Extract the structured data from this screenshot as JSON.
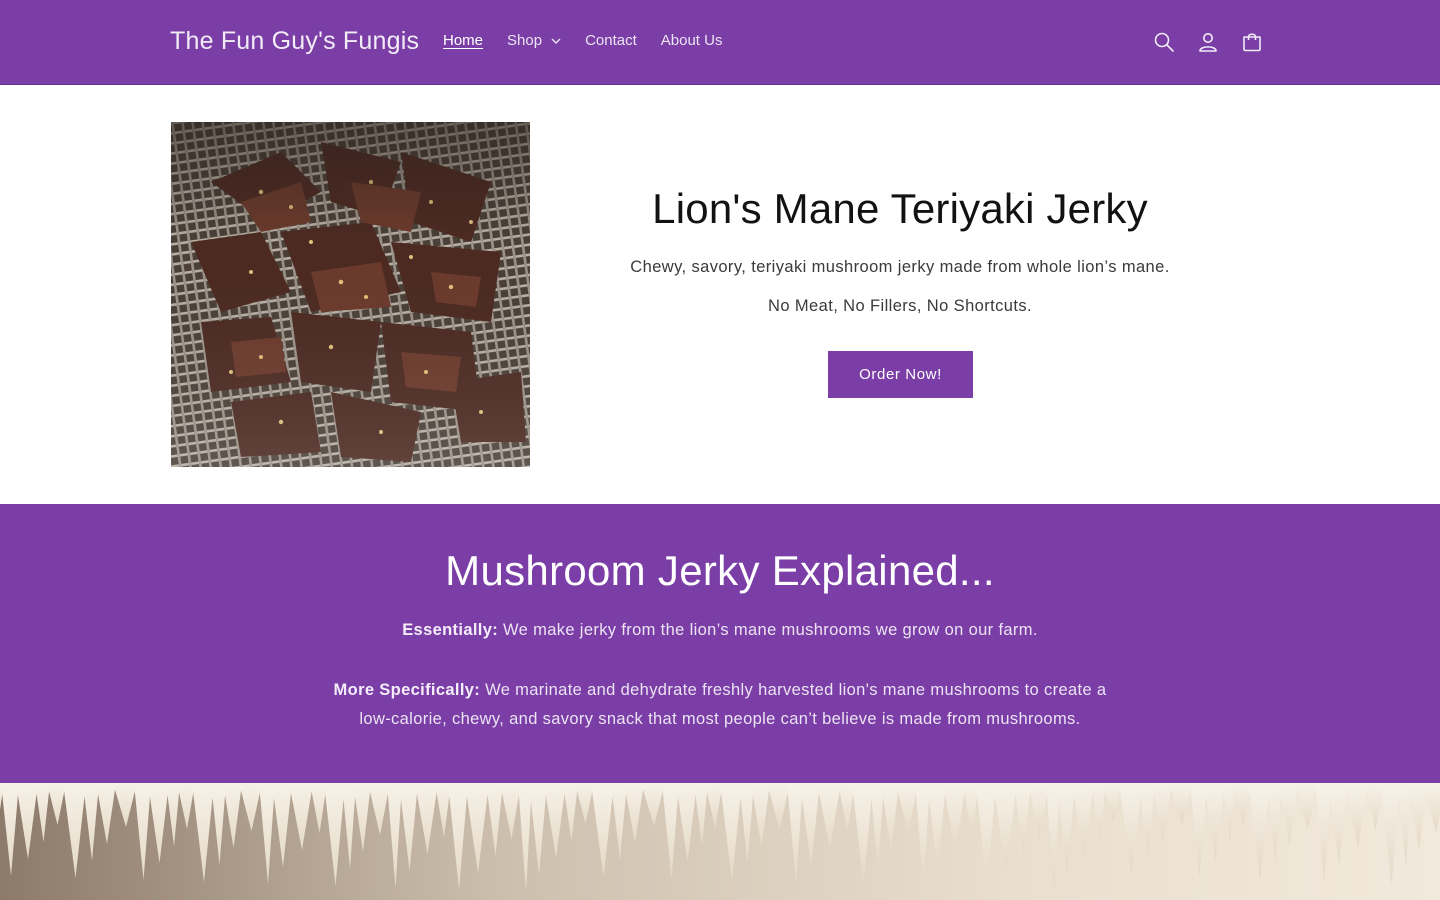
{
  "header": {
    "logo": "The Fun Guy's Fungis",
    "nav": [
      {
        "label": "Home",
        "active": true
      },
      {
        "label": "Shop",
        "dropdown": true
      },
      {
        "label": "Contact"
      },
      {
        "label": "About Us"
      }
    ],
    "icons": [
      "search-icon",
      "account-icon",
      "cart-icon"
    ]
  },
  "hero": {
    "image_name": "dried mushroom jerky on wire rack",
    "title": "Lion's Mane Teriyaki Jerky",
    "subtitle": "Chewy, savory, teriyaki mushroom jerky made from whole lion’s mane.",
    "subtitle2": "No Meat, No Fillers, No Shortcuts.",
    "button": "Order Now!"
  },
  "explain": {
    "title": "Mushroom Jerky Explained...",
    "p1_bold": "Essentially:",
    "p1_text": " We make jerky from the lion’s mane mushrooms we grow on our farm.",
    "p2_bold": "More Specifically:",
    "p2_text": " We marinate and dehydrate freshly harvested lion's mane mushrooms to create a low-calorie, chewy, and savory snack that most people can’t believe is made from mushrooms."
  },
  "banner": {
    "image_name": "lion's mane mushroom spines close-up"
  },
  "colors": {
    "brand_purple": "#7a3ea6",
    "text_dark": "#121212",
    "text_light": "#ece3f3"
  }
}
